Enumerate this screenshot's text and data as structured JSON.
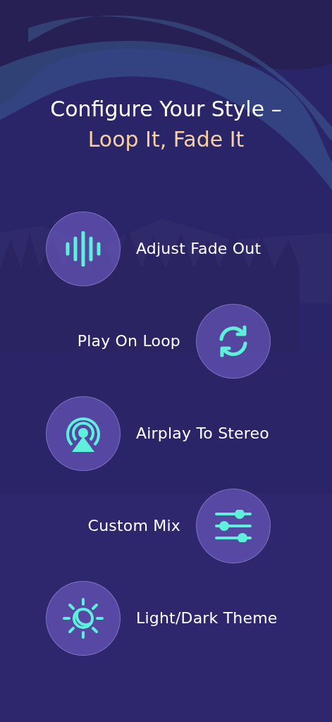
{
  "headline": {
    "line_1": "Configure Your Style –",
    "line_2": "Loop It, Fade It"
  },
  "features": [
    {
      "label": "Adjust Fade Out",
      "kind": "waveform"
    },
    {
      "label": "Play On Loop",
      "kind": "loop"
    },
    {
      "label": "Airplay To Stereo",
      "kind": "airplay"
    },
    {
      "label": "Custom Mix",
      "kind": "sliders"
    },
    {
      "label": "Light/Dark Theme",
      "kind": "theme"
    }
  ]
}
